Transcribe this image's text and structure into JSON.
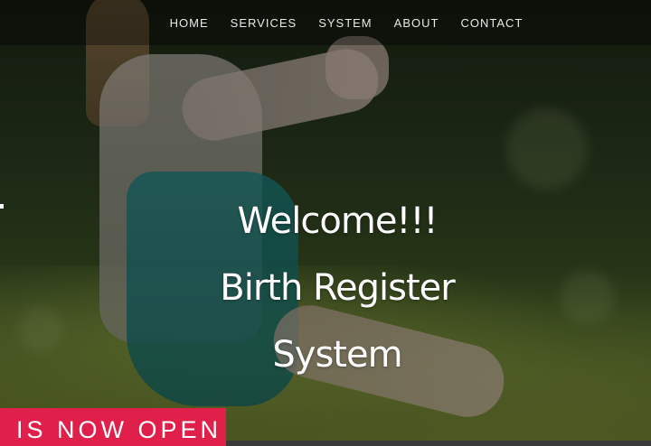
{
  "nav": {
    "items": [
      {
        "label": "HOME"
      },
      {
        "label": "SERVICES"
      },
      {
        "label": "SYSTEM"
      },
      {
        "label": "ABOUT"
      },
      {
        "label": "CONTACT"
      }
    ]
  },
  "hero": {
    "line1": "Welcome!!!",
    "line2": "Birth Register",
    "line3": "System"
  },
  "banner": {
    "text": "IS NOW OPEN"
  },
  "colors": {
    "banner_bg": "#e0204a",
    "nav_text": "#e8e8e8",
    "hero_text": "#ffffff"
  }
}
